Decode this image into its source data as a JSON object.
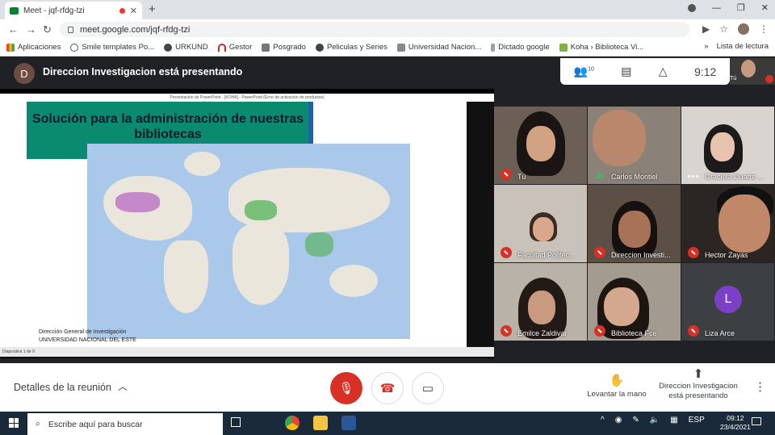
{
  "browser": {
    "tab_title": "Meet - jqf-rfdg-tzi",
    "url": "meet.google.com/jqf-rfdg-tzi",
    "bookmarks": [
      "Aplicaciones",
      "Smile templates Po...",
      "URKUND",
      "Gestor",
      "Posgrado",
      "Peliculas y Series",
      "Universidad Nacion...",
      "Dictado google",
      "Koha › Biblioteca Vi..."
    ],
    "reading_list": "Lista de lectura"
  },
  "meet": {
    "presenter_initial": "D",
    "presenting_banner": "Direccion Investigacion está presentando",
    "participant_count": "10",
    "time": "9:12",
    "self_label": "Tú"
  },
  "slide": {
    "window_title": "Presentación de PowerPoint - [KOHA] - PowerPoint (Error de activación de productos)",
    "title": "Solución para la administración de nuestras bibliotecas",
    "footer_line1": "Dirección General de Investigación",
    "footer_line2": "UNIVERSIDAD NACIONAL DEL ESTE",
    "status": "Diapositiva 1 de 9"
  },
  "participants": [
    {
      "name": "Tú",
      "state": "muted"
    },
    {
      "name": "Carlos Montiel",
      "state": "speaking"
    },
    {
      "name": "Graciela Duarte ...",
      "state": "more"
    },
    {
      "name": "Facultad Politec...",
      "state": "muted"
    },
    {
      "name": "Direccion Investi...",
      "state": "muted"
    },
    {
      "name": "Hector Zayas",
      "state": "muted"
    },
    {
      "name": "Emilce Zaldivar",
      "state": "muted"
    },
    {
      "name": "Biblioteca Fce",
      "state": "muted"
    },
    {
      "name": "Liza Arce",
      "state": "muted",
      "initial": "L"
    }
  ],
  "controls": {
    "details": "Detalles de la reunión",
    "raise_hand": "Levantar la mano",
    "present_line1": "Direccion Investigacion",
    "present_line2": "está presentando"
  },
  "taskbar": {
    "search_placeholder": "Escribe aquí para buscar",
    "lang": "ESP",
    "clock_time": "09:12",
    "clock_date": "23/4/2021"
  },
  "colors": {
    "accent_red": "#d93025",
    "meet_bg": "#202124",
    "slide_title_bg": "#0a8a6e",
    "avatar_purple": "#7b3fc8"
  }
}
